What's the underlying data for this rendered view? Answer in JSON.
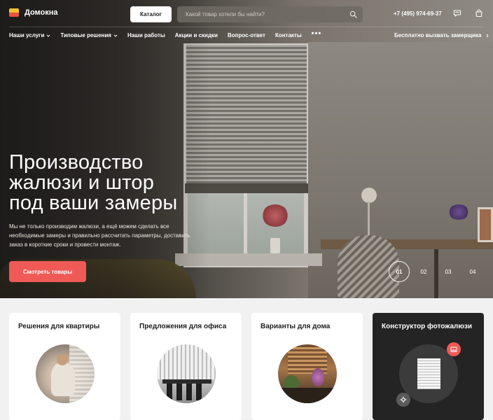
{
  "header": {
    "logo_text": "Домокна",
    "catalog_label": "Каталог",
    "search_placeholder": "Какой товар хотели бы найти?",
    "phone": "+7 (495) 974-69-37"
  },
  "nav": {
    "items": [
      {
        "label": "Наши услуги",
        "dropdown": true
      },
      {
        "label": "Типовые решения",
        "dropdown": true
      },
      {
        "label": "Наши работы",
        "dropdown": false
      },
      {
        "label": "Акции и скидки",
        "dropdown": false
      },
      {
        "label": "Вопрос-ответ",
        "dropdown": false
      },
      {
        "label": "Контакты",
        "dropdown": false
      }
    ],
    "more_label": "•••",
    "right_link": "Бесплатно вызвать замерщика"
  },
  "hero": {
    "title_lines": [
      "Производство",
      "жалюзи и штор",
      "под ваши замеры"
    ],
    "description": "Мы не только производим жалюзи, а ещё можем сделать все необходимые замеры и правильно рассчитать параметры, доставить заказ в короткие сроки и провести монтаж.",
    "cta_label": "Смотреть товары",
    "slides": [
      "01",
      "02",
      "03",
      "04"
    ],
    "active_slide": "01"
  },
  "cards": [
    {
      "title": "Решения для квартиры"
    },
    {
      "title": "Предложения для офиса"
    },
    {
      "title": "Варианты для дома"
    },
    {
      "title": "Конструктор фотожалюзи"
    }
  ],
  "colors": {
    "accent": "#ef5a57",
    "dark_card": "#242424",
    "logo_top": "#f4c033",
    "logo_bottom": "#e8543c"
  },
  "icons": [
    "search-icon",
    "chat-icon",
    "cart-icon",
    "chevron-down-icon",
    "chevron-right-icon",
    "photo-icon",
    "gear-icon"
  ]
}
